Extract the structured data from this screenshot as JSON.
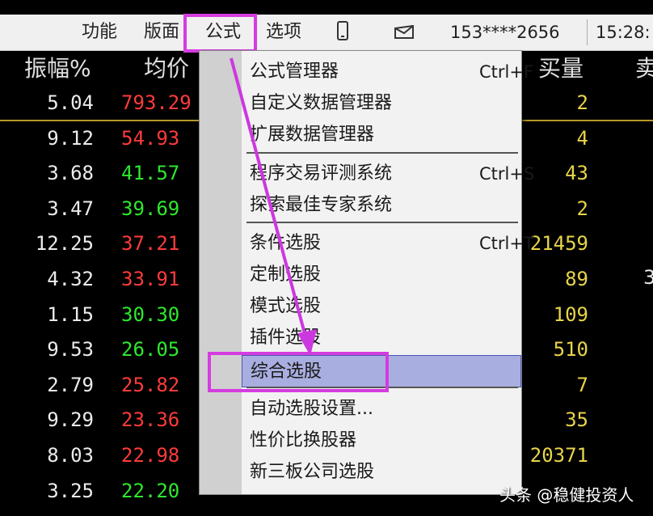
{
  "menubar": {
    "items": [
      "功能",
      "版面",
      "公式",
      "选项"
    ],
    "account": "153****2656",
    "time": "15:28:"
  },
  "columns": {
    "amplitude": "振幅%",
    "avg_price": "均价",
    "buy_volume": "买量",
    "partial": "卖"
  },
  "rows": [
    {
      "amplitude": "5.04",
      "avg": "793.29",
      "avg_color": "red",
      "vol": "2"
    },
    {
      "amplitude": "9.12",
      "avg": "54.93",
      "avg_color": "red",
      "vol": "4"
    },
    {
      "amplitude": "3.68",
      "avg": "41.57",
      "avg_color": "green",
      "vol": "43"
    },
    {
      "amplitude": "3.47",
      "avg": "39.69",
      "avg_color": "green",
      "vol": "2"
    },
    {
      "amplitude": "12.25",
      "avg": "37.21",
      "avg_color": "red",
      "vol": "21459"
    },
    {
      "amplitude": "4.32",
      "avg": "33.91",
      "avg_color": "red",
      "vol": "89"
    },
    {
      "amplitude": "1.15",
      "avg": "30.30",
      "avg_color": "green",
      "vol": "109"
    },
    {
      "amplitude": "9.53",
      "avg": "26.05",
      "avg_color": "green",
      "vol": "510"
    },
    {
      "amplitude": "2.79",
      "avg": "25.82",
      "avg_color": "red",
      "vol": "7"
    },
    {
      "amplitude": "9.29",
      "avg": "23.36",
      "avg_color": "red",
      "vol": "35"
    },
    {
      "amplitude": "8.03",
      "avg": "22.98",
      "avg_color": "red",
      "vol": "20371"
    },
    {
      "amplitude": "3.25",
      "avg": "22.20",
      "avg_color": "green",
      "vol": ""
    }
  ],
  "menu": {
    "items": [
      {
        "label": "公式管理器",
        "shortcut": "Ctrl+F"
      },
      {
        "label": "自定义数据管理器",
        "shortcut": ""
      },
      {
        "label": "扩展数据管理器",
        "shortcut": ""
      },
      {
        "label": "程序交易评测系统",
        "shortcut": "Ctrl+S"
      },
      {
        "label": "探索最佳专家系统",
        "shortcut": ""
      },
      {
        "label": "条件选股",
        "shortcut": "Ctrl+T"
      },
      {
        "label": "定制选股",
        "shortcut": ""
      },
      {
        "label": "模式选股",
        "shortcut": ""
      },
      {
        "label": "插件选股",
        "shortcut": ""
      },
      {
        "label": "综合选股",
        "shortcut": ""
      },
      {
        "label": "自动选股设置...",
        "shortcut": ""
      },
      {
        "label": "性价比换股器",
        "shortcut": ""
      },
      {
        "label": "新三板公司选股",
        "shortcut": ""
      }
    ]
  },
  "watermark": "头条 @稳健投资人",
  "colors": {
    "highlight": "#d43ce0",
    "selected_bg": "#a9aee0",
    "up": "#ff3b3b",
    "down": "#2ee82e",
    "volume": "#e8d44a"
  }
}
